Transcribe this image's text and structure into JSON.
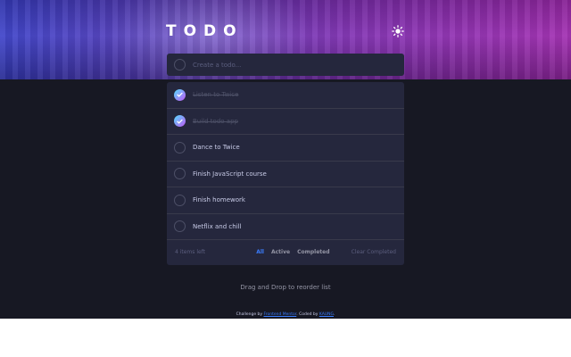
{
  "header": {
    "title": "TODO",
    "theme_icon": "sun-icon"
  },
  "new_todo": {
    "placeholder": "Create a todo..."
  },
  "todos": [
    {
      "text": "Listen to Twice",
      "completed": true
    },
    {
      "text": "Build todo app",
      "completed": true
    },
    {
      "text": "Dance to Twice",
      "completed": false
    },
    {
      "text": "Finish JavaScript course",
      "completed": false
    },
    {
      "text": "Finish homework",
      "completed": false
    },
    {
      "text": "Netflix and chill",
      "completed": false
    }
  ],
  "footer": {
    "items_left": "4 items left",
    "filters": [
      "All",
      "Active",
      "Completed"
    ],
    "active_filter": "All",
    "clear_label": "Clear Completed"
  },
  "hint": "Drag and Drop to reorder list",
  "attribution": {
    "prefix": "Challenge by",
    "challenge_link": "Frontend Mentor",
    "middle": ". Coded by",
    "author_link": "KAUNG",
    "suffix": "."
  },
  "colors": {
    "accent": "#3a7cfd",
    "check_gradient_start": "#55ddff",
    "check_gradient_end": "#c058f3",
    "background": "#171823",
    "card": "#25273d"
  }
}
